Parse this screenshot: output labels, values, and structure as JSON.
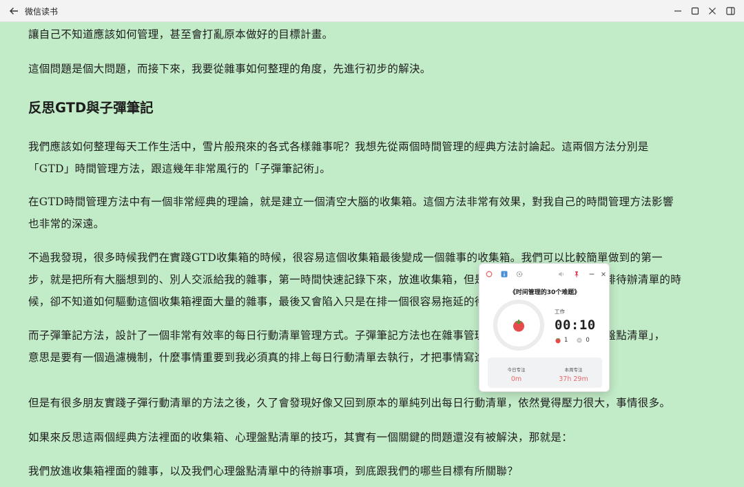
{
  "window": {
    "title": "微信读书"
  },
  "content": {
    "paragraphs": [
      "讓自己不知道應該如何管理，甚至會打亂原本做好的目標計畫。",
      "這個問題是個大問題，而接下來，我要從雜事如何整理的角度，先進行初步的解決。",
      "我們應該如何整理每天工作生活中，雪片般飛來的各式各樣雜事呢？我想先從兩個時間管理的經典方法討論起。這兩個方法分別是",
      "「GTD」時間管理方法，跟這幾年非常風行的「子彈筆記術」。",
      "在GTD時間管理方法中有一個非常經典的理論，就是建立一個清空大腦的收集箱。這個方法非常有效果，對我自己的時間管理方法影響",
      "也非常的深遠。",
      "不過我發現，很多時候我們在實踐GTD收集箱的時候，很容易這個收集箱最後變成一個雜事的收集箱。我們可以比較簡單做到的第一",
      "步，就是把所有大腦想到的、別人交派給我的雜事，第一時間快速記錄下來，放進收集箱，但是等到我們要從收集箱到安排待辦清單的時",
      "候，卻不知道如何驅動這個收集箱裡面大量的雜事，最後又會陷入只是在排一個很容易拖延的待辦清單。",
      "而子彈筆記方法，設計了一個非常有效率的每日行動清單管理方式。子彈筆記方法也在雜事管理裡面，提出了一個「心理盤點清單」，",
      "意思是要有一個過濾機制，什麼事情重要到我必須真的排上每日行動清單去執行，才把事情寫進去。",
      "但是有很多朋友實踐子彈行動清單的方法之後，久了會發現好像又回到原本的單純列出每日行動清單，依然覺得壓力很大，事情很多。",
      "如果來反思這兩個經典方法裡面的收集箱、心理盤點清單的技巧，其實有一個關鍵的問題還沒有被解決，那就是：",
      "我們放進收集箱裡面的雜事，以及我們心理盤點清單中的待辦事項，到底跟我們的哪些目標有所關聯？"
    ],
    "heading": "反思GTD與子彈筆記"
  },
  "pomodoro": {
    "task_title": "《时间管理的30个难题》",
    "mode": "工作",
    "timer": "00:10",
    "tomato_count": "1",
    "interruption_count": "0",
    "today_label": "今日专注",
    "today_value": "0m",
    "week_label": "本周专注",
    "week_value": "37h 29m",
    "icons": [
      "record-icon",
      "info-icon",
      "settings-icon",
      "sound-icon",
      "pin-icon",
      "minimize-icon",
      "close-icon"
    ],
    "colors": {
      "accent": "#e66a6a",
      "pin": "#e0405a",
      "info": "#4a90d9"
    }
  },
  "colors": {
    "page_background": "#c2ecc8",
    "titlebar": "#f3f3f3",
    "text": "#1d1d1d"
  }
}
